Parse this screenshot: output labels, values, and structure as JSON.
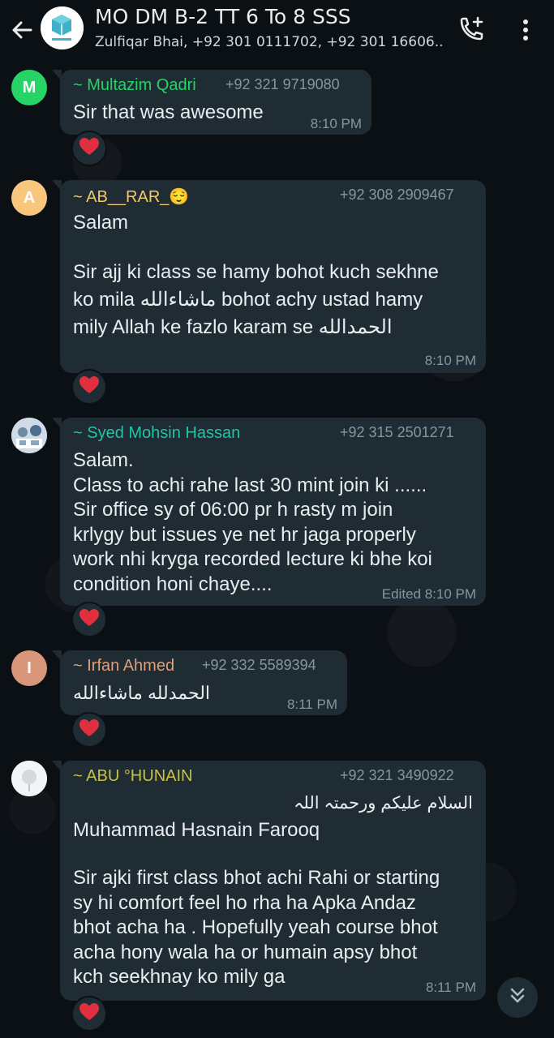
{
  "header": {
    "title": "MO DM B-2 TT 6 To 8 SSS",
    "subtitle": "Zulfiqar Bhai, +92 301 0111702, +92 301 16606..."
  },
  "colors": {
    "background": "#0b1014",
    "bubble": "#1f2c34",
    "text": "#e9edef",
    "meta": "#8696a0",
    "heart": "#e0303f"
  },
  "messages": [
    {
      "sender": "~ Multazim Qadri",
      "sender_color": "#25d366",
      "phone": "+92 321 9719080",
      "avatar_letter": "M",
      "avatar_color": "#25d366",
      "lines": [
        "Sir that was awesome"
      ],
      "time": "8:10 PM",
      "reaction": "heart-icon"
    },
    {
      "sender": "~ AB__RAR_",
      "sender_emoji": "😌",
      "sender_color": "#f5c86a",
      "phone": "+92 308 2909467",
      "avatar_letter": "A",
      "avatar_color": "#f8c77d",
      "lines": [
        "Salam",
        "",
        "Sir ajj ki class se hamy bohot kuch sekhne",
        "ko mila ماشاءالله bohot achy ustad hamy",
        "mily Allah ke fazlo karam se الحمدالله"
      ],
      "time": "8:10 PM",
      "reaction": "heart-icon"
    },
    {
      "sender": "~ Syed Mohsin Hassan",
      "sender_color": "#21c4a5",
      "phone": "+92 315 2501271",
      "lines": [
        "Salam.",
        "Class to achi rahe last 30 mint join ki  ......",
        "Sir office sy of 06:00  pr h rasty m join",
        "krlygy but issues ye net hr jaga properly",
        "work nhi kryga recorded lecture ki bhe koi",
        "condition honi chaye...."
      ],
      "edited": "Edited",
      "time": "8:10 PM",
      "reaction": "heart-icon"
    },
    {
      "sender": "~ Irfan Ahmed",
      "sender_color": "#e0a07a",
      "phone": "+92 332 5589394",
      "avatar_letter": "I",
      "avatar_color": "#d8967a",
      "lines": [
        "الحمدلله ماشاءالله"
      ],
      "time": "8:11 PM",
      "reaction": "heart-icon"
    },
    {
      "sender": "~ ABU °HUNAIN",
      "sender_color": "#c7c244",
      "phone": "+92 321 3490922",
      "lines": [
        "السلام علیکم ورحمتہ اللہ",
        "Muhammad Hasnain Farooq",
        "",
        "Sir ajki first class bhot achi Rahi or starting",
        "sy hi  comfort feel ho rha ha Apka Andaz",
        "bhot acha ha . Hopefully yeah course bhot",
        "acha hony wala ha or humain apsy bhot",
        "kch seekhnay ko mily ga"
      ],
      "time": "8:11 PM",
      "reaction": "heart-icon"
    }
  ]
}
